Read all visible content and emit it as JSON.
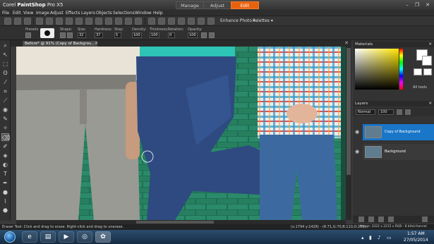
{
  "app": {
    "title_prefix": "Corel ",
    "title_brand": "PaintShop",
    "title_suffix": " Pro X5"
  },
  "modes": [
    "Manage",
    "Adjust",
    "Edit"
  ],
  "active_mode": "Edit",
  "menu": [
    "File",
    "Edit",
    "View",
    "Image",
    "Adjust",
    "Effects",
    "Layers",
    "Objects",
    "Selections",
    "Window",
    "Help"
  ],
  "toolbar": {
    "enhance_photo": "Enhance Photo ▾",
    "palettes": "Palettes ▾"
  },
  "options": {
    "presets_label": "Presets",
    "shape_label": "Shape:",
    "size_label": "Size:",
    "size_value": "32",
    "hardness_label": "Hardness:",
    "hardness_value": "37",
    "step_label": "Step:",
    "step_value": "5",
    "density_label": "Density:",
    "density_value": "100",
    "thickness_label": "Thickness:",
    "thickness_value": "100",
    "rotation_label": "Rotation:",
    "rotation_value": "0",
    "opacity_label": "Opacity:",
    "opacity_value": "100"
  },
  "document": {
    "tab_label": "Before* @  91% (Copy of Backgrou..."
  },
  "panels": {
    "materials_title": "Materials",
    "all_tools": "All tools",
    "layers_title": "Layers",
    "blend_mode": "Normal",
    "layer_opacity": "100",
    "layers": [
      {
        "name": "Copy of Background",
        "selected": true
      },
      {
        "name": "Background",
        "selected": false
      }
    ]
  },
  "status": {
    "hint": "Eraser Tool: Click and drag to erase. Right-click and drag to unerase.",
    "coords": "(x:1794 y:1428) - (R:71,G:70,B:110,O:255)",
    "image_info": "Image: 3322 x 2215 x RGB - 8 bits/channel"
  },
  "taskbar": {
    "time": "1:57 AM",
    "date": "27/05/2014"
  },
  "colors": {
    "accent": "#e8620e",
    "selection": "#1976c8"
  }
}
